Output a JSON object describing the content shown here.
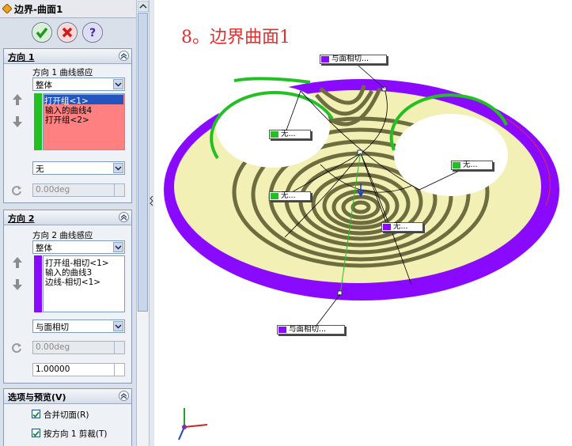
{
  "window": {
    "title": "边界-曲面1"
  },
  "toolbar": {
    "ok_icon": "check-icon",
    "cancel_icon": "x-icon",
    "help_icon": "question-icon"
  },
  "direction1": {
    "header": "方向 1",
    "curve_influence_label": "方向 1 曲线感应",
    "influence_value": "整体",
    "items": [
      "打开组<1>",
      "输入的曲线4",
      "打开组<2>"
    ],
    "tangency_value": "无",
    "angle_value": "0.00deg",
    "color": "#22c022"
  },
  "direction2": {
    "header": "方向 2",
    "curve_influence_label": "方向 2 曲线感应",
    "influence_value": "整体",
    "items": [
      "打开组-相切<1>",
      "输入的曲线3",
      "边线-相切<1>"
    ],
    "tangency_value": "与面相切",
    "angle_value": "0.00deg",
    "weight_value": "1.00000",
    "color": "#8a0aff"
  },
  "options": {
    "header": "选项与预览(V)",
    "merge_tangent_label": "合并切面(R)",
    "trim_by_dir1_label": "按方向 1 剪裁(T)"
  },
  "graphics": {
    "caption": "8。边界曲面1",
    "callouts": {
      "top": "与面相切...",
      "bottom": "与面相切...",
      "left_upper": "无...",
      "left_lower": "无...",
      "right": "无...",
      "center": "无..."
    },
    "colors": {
      "purple": "#8a0aff",
      "green": "#22c022",
      "red": "#e03030"
    }
  }
}
